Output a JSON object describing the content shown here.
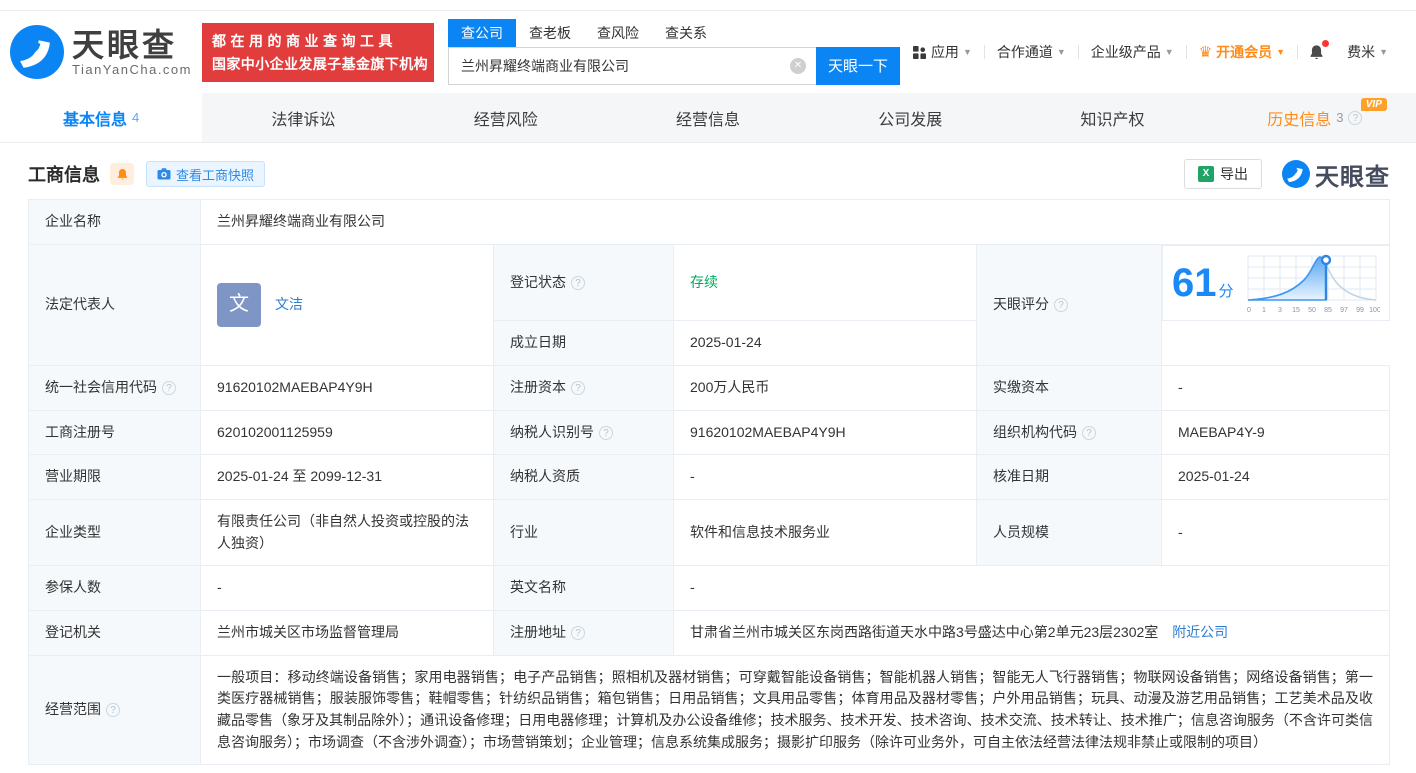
{
  "colors": {
    "accent": "#0b85f4",
    "orange": "#ff8c19",
    "green": "#00ab5f",
    "banner_red": "#e23d3d",
    "link": "#2d7dd2"
  },
  "header": {
    "logo_text": "天眼查",
    "logo_domain": "TianYanCha.com",
    "slogan1": "都在用的商业查询工具",
    "slogan2": "国家中小企业发展子基金旗下机构",
    "search_tabs": [
      {
        "label": "查公司"
      },
      {
        "label": "查老板"
      },
      {
        "label": "查风险"
      },
      {
        "label": "查关系"
      }
    ],
    "search_value": "兰州昇耀终端商业有限公司",
    "search_button": "天眼一下",
    "menu": [
      {
        "label": "应用"
      },
      {
        "label": "合作通道"
      },
      {
        "label": "企业级产品"
      },
      {
        "label": "开通会员"
      },
      {
        "label": "费米"
      }
    ]
  },
  "tabs": [
    {
      "label": "基本信息",
      "count": "4"
    },
    {
      "label": "法律诉讼"
    },
    {
      "label": "经营风险"
    },
    {
      "label": "经营信息"
    },
    {
      "label": "公司发展"
    },
    {
      "label": "知识产权"
    },
    {
      "label": "历史信息",
      "count": "3",
      "badge": "VIP"
    }
  ],
  "section": {
    "title": "工商信息",
    "snapshot_button": "查看工商快照",
    "export_button": "导出",
    "watermark": "天眼查"
  },
  "fields": {
    "company_name": {
      "label": "企业名称",
      "value": "兰州昇耀终端商业有限公司"
    },
    "legal_rep": {
      "label": "法定代表人",
      "avatar": "文",
      "value": "文洁"
    },
    "reg_status": {
      "label": "登记状态",
      "value": "存续"
    },
    "establish_date": {
      "label": "成立日期",
      "value": "2025-01-24"
    },
    "tyc_score": {
      "label": "天眼评分",
      "value": "61",
      "unit": "分",
      "ticks": [
        "0",
        "1",
        "3",
        "15",
        "50",
        "85",
        "97",
        "99",
        "100"
      ]
    },
    "credit_code": {
      "label": "统一社会信用代码",
      "value": "91620102MAEBAP4Y9H"
    },
    "reg_capital": {
      "label": "注册资本",
      "value": "200万人民币"
    },
    "paid_capital": {
      "label": "实缴资本",
      "value": "-"
    },
    "reg_number": {
      "label": "工商注册号",
      "value": "620102001125959"
    },
    "taxpayer_id": {
      "label": "纳税人识别号",
      "value": "91620102MAEBAP4Y9H"
    },
    "org_code": {
      "label": "组织机构代码",
      "value": "MAEBAP4Y-9"
    },
    "business_term": {
      "label": "营业期限",
      "value": "2025-01-24 至 2099-12-31"
    },
    "taxpayer_quality": {
      "label": "纳税人资质",
      "value": "-"
    },
    "approval_date": {
      "label": "核准日期",
      "value": "2025-01-24"
    },
    "company_type": {
      "label": "企业类型",
      "value": "有限责任公司（非自然人投资或控股的法人独资）"
    },
    "industry": {
      "label": "行业",
      "value": "软件和信息技术服务业"
    },
    "staff_size": {
      "label": "人员规模",
      "value": "-"
    },
    "insured_count": {
      "label": "参保人数",
      "value": "-"
    },
    "english_name": {
      "label": "英文名称",
      "value": "-"
    },
    "reg_authority": {
      "label": "登记机关",
      "value": "兰州市城关区市场监督管理局"
    },
    "reg_address": {
      "label": "注册地址",
      "value": "甘肃省兰州市城关区东岗西路街道天水中路3号盛达中心第2单元23层2302室",
      "link": "附近公司"
    },
    "business_scope": {
      "label": "经营范围",
      "value": "一般项目：移动终端设备销售；家用电器销售；电子产品销售；照相机及器材销售；可穿戴智能设备销售；智能机器人销售；智能无人飞行器销售；物联网设备销售；网络设备销售；第一类医疗器械销售；服装服饰零售；鞋帽零售；针纺织品销售；箱包销售；日用品销售；文具用品零售；体育用品及器材零售；户外用品销售；玩具、动漫及游艺用品销售；工艺美术品及收藏品零售（象牙及其制品除外）；通讯设备修理；日用电器修理；计算机及办公设备维修；技术服务、技术开发、技术咨询、技术交流、技术转让、技术推广；信息咨询服务（不含许可类信息咨询服务）；市场调查（不含涉外调查）；市场营销策划；企业管理；信息系统集成服务；摄影扩印服务（除许可业务外，可自主依法经营法律法规非禁止或限制的项目）"
    }
  }
}
